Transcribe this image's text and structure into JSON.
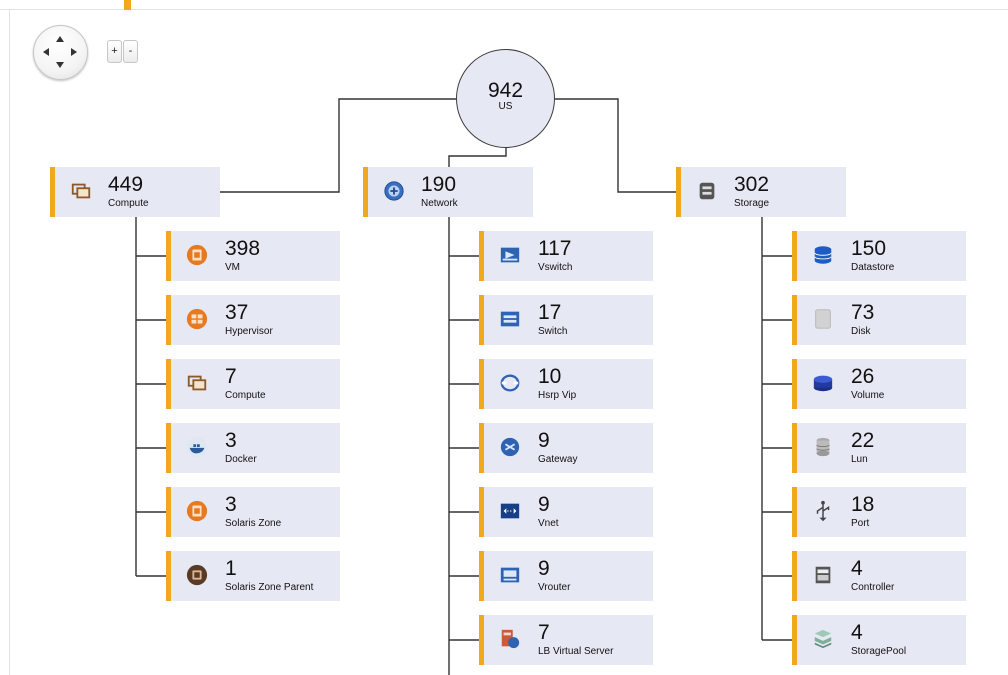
{
  "controls": {
    "pan_up": "▲",
    "pan_down": "▼",
    "pan_left": "◀",
    "pan_right": "▶",
    "zoom_in": "+",
    "zoom_out": "-"
  },
  "root": {
    "count": "942",
    "label": "US"
  },
  "branches": [
    {
      "count": "449",
      "label": "Compute",
      "icon": "compute-icon",
      "children": [
        {
          "count": "398",
          "label": "VM",
          "icon": "vm-icon"
        },
        {
          "count": "37",
          "label": "Hypervisor",
          "icon": "hypervisor-icon"
        },
        {
          "count": "7",
          "label": "Compute",
          "icon": "compute-icon"
        },
        {
          "count": "3",
          "label": "Docker",
          "icon": "docker-icon"
        },
        {
          "count": "3",
          "label": "Solaris Zone",
          "icon": "solaris-zone-icon"
        },
        {
          "count": "1",
          "label": "Solaris Zone Parent",
          "icon": "solaris-zone-parent-icon"
        }
      ]
    },
    {
      "count": "190",
      "label": "Network",
      "icon": "network-icon",
      "children": [
        {
          "count": "117",
          "label": "Vswitch",
          "icon": "vswitch-icon"
        },
        {
          "count": "17",
          "label": "Switch",
          "icon": "switch-icon"
        },
        {
          "count": "10",
          "label": "Hsrp Vip",
          "icon": "hsrp-vip-icon"
        },
        {
          "count": "9",
          "label": "Gateway",
          "icon": "gateway-icon"
        },
        {
          "count": "9",
          "label": "Vnet",
          "icon": "vnet-icon"
        },
        {
          "count": "9",
          "label": "Vrouter",
          "icon": "vrouter-icon"
        },
        {
          "count": "7",
          "label": "LB Virtual Server",
          "icon": "lb-virtual-server-icon"
        }
      ]
    },
    {
      "count": "302",
      "label": "Storage",
      "icon": "storage-icon",
      "children": [
        {
          "count": "150",
          "label": "Datastore",
          "icon": "datastore-icon"
        },
        {
          "count": "73",
          "label": "Disk",
          "icon": "disk-icon"
        },
        {
          "count": "26",
          "label": "Volume",
          "icon": "volume-icon"
        },
        {
          "count": "22",
          "label": "Lun",
          "icon": "lun-icon"
        },
        {
          "count": "18",
          "label": "Port",
          "icon": "port-icon"
        },
        {
          "count": "4",
          "label": "Controller",
          "icon": "controller-icon"
        },
        {
          "count": "4",
          "label": "StoragePool",
          "icon": "storagepool-icon"
        }
      ]
    }
  ],
  "colors": {
    "accent": "#f0a81c",
    "node_bg": "#e6e9f4",
    "line": "#333333"
  }
}
